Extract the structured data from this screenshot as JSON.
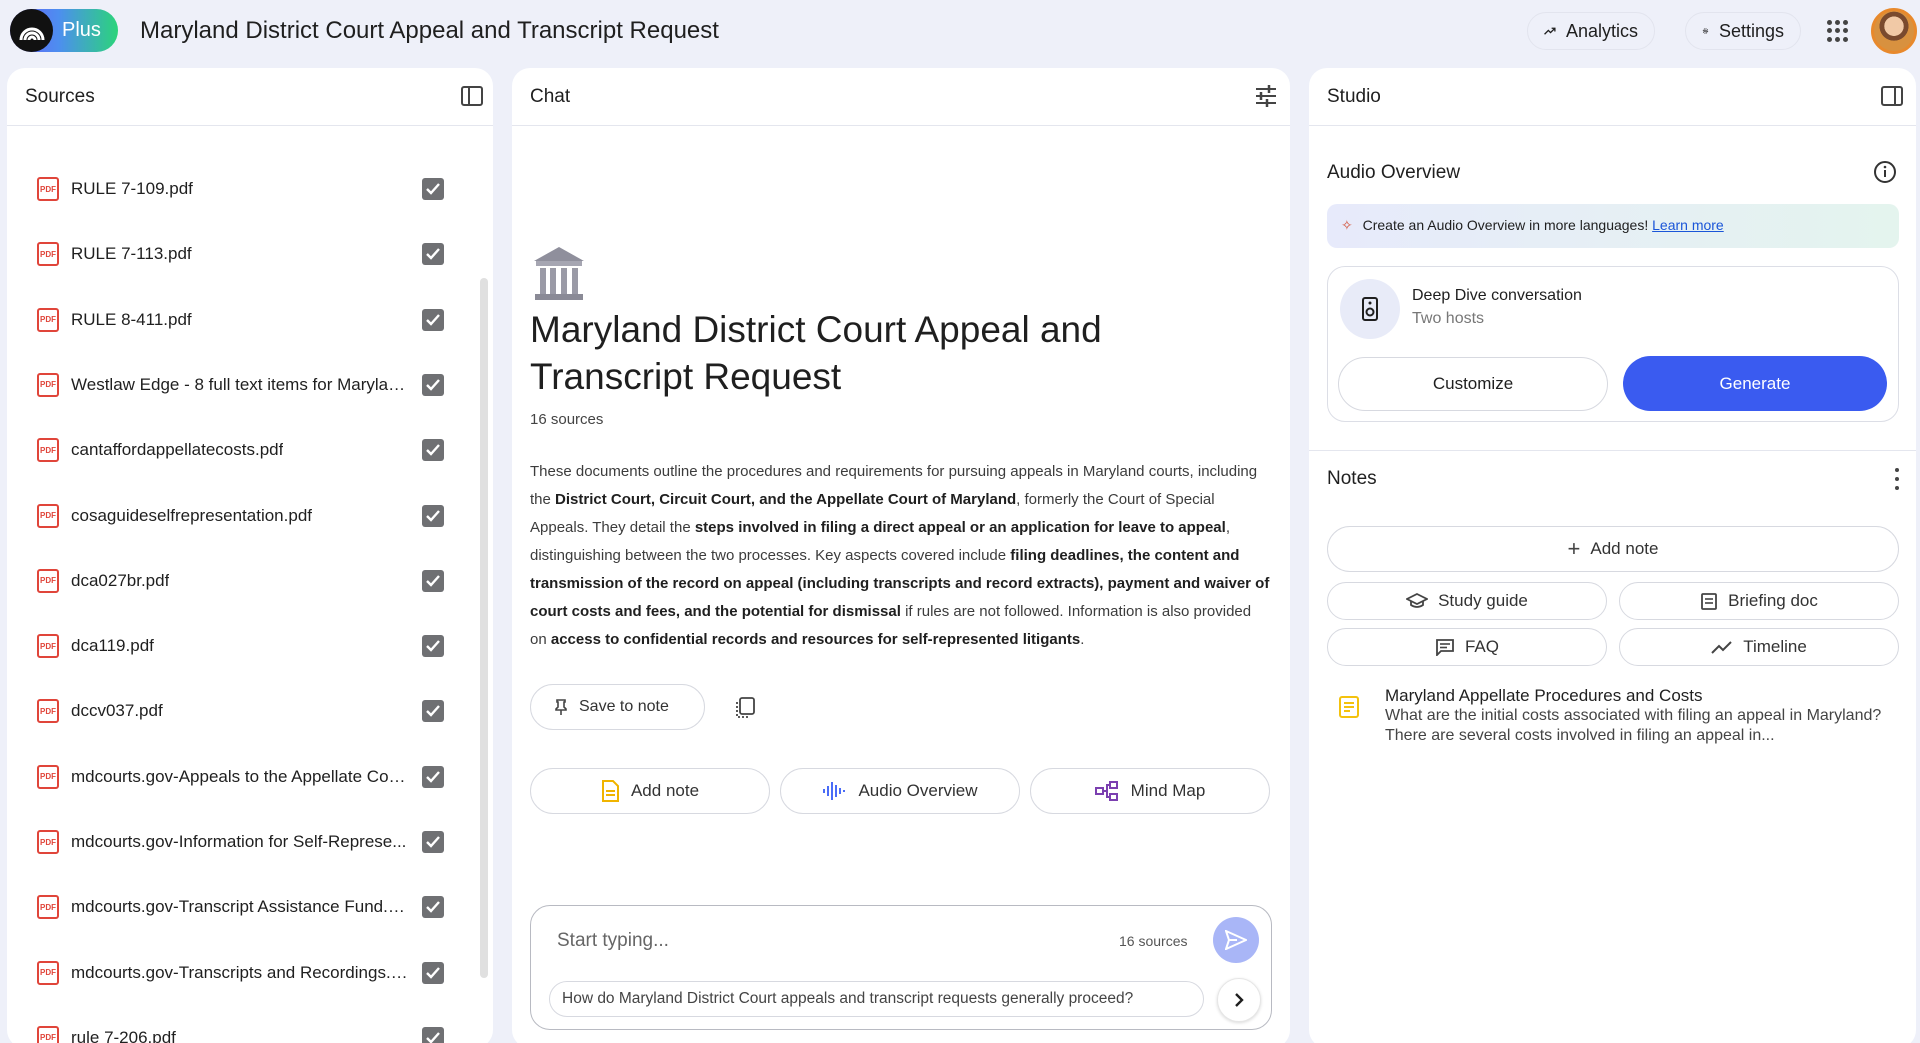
{
  "header": {
    "logo_label": "Plus",
    "title": "Maryland District Court Appeal and Transcript Request",
    "analytics_label": "Analytics",
    "settings_label": "Settings"
  },
  "sources": {
    "title": "Sources",
    "items": [
      {
        "name": "RULE 7-109.pdf",
        "checked": true
      },
      {
        "name": "RULE 7-113.pdf",
        "checked": true
      },
      {
        "name": "RULE 8-411.pdf",
        "checked": true
      },
      {
        "name": "Westlaw Edge - 8 full text items for Marylan...",
        "checked": true
      },
      {
        "name": "cantaffordappellatecosts.pdf",
        "checked": true
      },
      {
        "name": "cosaguideselfrepresentation.pdf",
        "checked": true
      },
      {
        "name": "dca027br.pdf",
        "checked": true
      },
      {
        "name": "dca119.pdf",
        "checked": true
      },
      {
        "name": "dccv037.pdf",
        "checked": true
      },
      {
        "name": "mdcourts.gov-Appeals to the Appellate Cou...",
        "checked": true
      },
      {
        "name": "mdcourts.gov-Information for Self-Represe...",
        "checked": true
      },
      {
        "name": "mdcourts.gov-Transcript Assistance Fund.pdf",
        "checked": true
      },
      {
        "name": "mdcourts.gov-Transcripts and Recordings.pdf",
        "checked": true
      },
      {
        "name": "rule 7-206.pdf",
        "checked": true
      }
    ],
    "pdf_badge": "PDF"
  },
  "chat": {
    "title": "Chat",
    "emoji": "classical-building",
    "notebook_title": "Maryland District Court Appeal and Transcript Request",
    "source_count": "16 sources",
    "summary_parts": [
      {
        "text": "These documents outline the procedures and requirements for pursuing appeals in Maryland courts, including the ",
        "bold": false
      },
      {
        "text": "District Court, Circuit Court, and the Appellate Court of Maryland",
        "bold": true
      },
      {
        "text": ", formerly the Court of Special Appeals. They detail the ",
        "bold": false
      },
      {
        "text": "steps involved in filing a direct appeal or an application for leave to appeal",
        "bold": true
      },
      {
        "text": ", distinguishing between the two processes. Key aspects covered include ",
        "bold": false
      },
      {
        "text": "filing deadlines, the content and transmission of the record on appeal (including transcripts and record extracts), payment and waiver of court costs and fees, and the potential for dismissal",
        "bold": true
      },
      {
        "text": " if rules are not followed. Information is also provided on ",
        "bold": false
      },
      {
        "text": "access to confidential records and resources for self-represented litigants",
        "bold": true
      },
      {
        "text": ".",
        "bold": false
      }
    ],
    "save_to_note": "Save to note",
    "actions": {
      "add_note": "Add note",
      "audio_overview": "Audio Overview",
      "mind_map": "Mind Map"
    },
    "input": {
      "placeholder": "Start typing...",
      "source_count": "16 sources",
      "suggestion": "How do Maryland District Court appeals and transcript requests generally proceed?"
    }
  },
  "studio": {
    "title": "Studio",
    "audio_overview_title": "Audio Overview",
    "banner_text": "Create an Audio Overview in more languages!",
    "banner_link": "Learn more",
    "deep_dive_title": "Deep Dive conversation",
    "deep_dive_sub": "Two hosts",
    "customize": "Customize",
    "generate": "Generate",
    "notes_title": "Notes",
    "add_note": "Add note",
    "tools": {
      "study_guide": "Study guide",
      "briefing_doc": "Briefing doc",
      "faq": "FAQ",
      "timeline": "Timeline"
    },
    "notes": [
      {
        "title": "Maryland Appellate Procedures and Costs",
        "body": "What are the initial costs associated with filing an appeal in Maryland? There are several costs involved in filing an appeal in..."
      }
    ]
  },
  "colors": {
    "accent": "#3a5bf0",
    "pdf_red": "#e0453a",
    "background": "#eef0f9",
    "note_yellow": "#f4c20d"
  }
}
